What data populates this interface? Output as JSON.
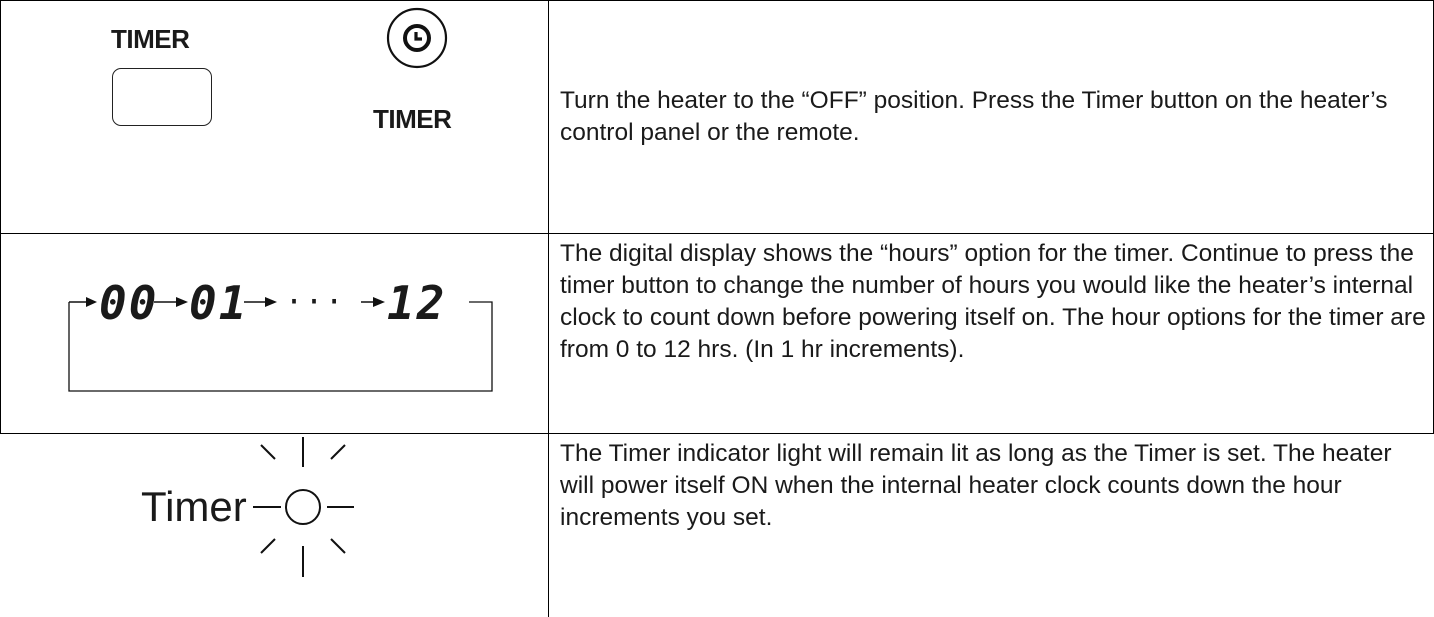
{
  "rows": [
    {
      "panel_label": "TIMER",
      "remote_label": "TIMER",
      "text": "Turn the heater to the “OFF” position. Press the Timer button on the heater’s control panel or the remote."
    },
    {
      "display_values": [
        "00",
        "01",
        "···",
        "12"
      ],
      "text": "The digital display shows the “hours” option for the timer. Continue to press the timer button to change the number of hours you would like the heater’s internal clock to count down before powering itself on. The hour options for the timer are from 0 to 12 hrs. (In 1 hr increments)."
    },
    {
      "indicator_label": "Timer",
      "text": "The Timer indicator light will remain lit as long as the Timer is set. The heater will power itself ON when the internal heater clock counts down the hour increments you set."
    }
  ],
  "icons": {
    "panel_button": "blank-button-icon",
    "remote_button": "clock-icon",
    "cycle": "cycle-arrow-icon",
    "indicator": "indicator-light-icon"
  }
}
